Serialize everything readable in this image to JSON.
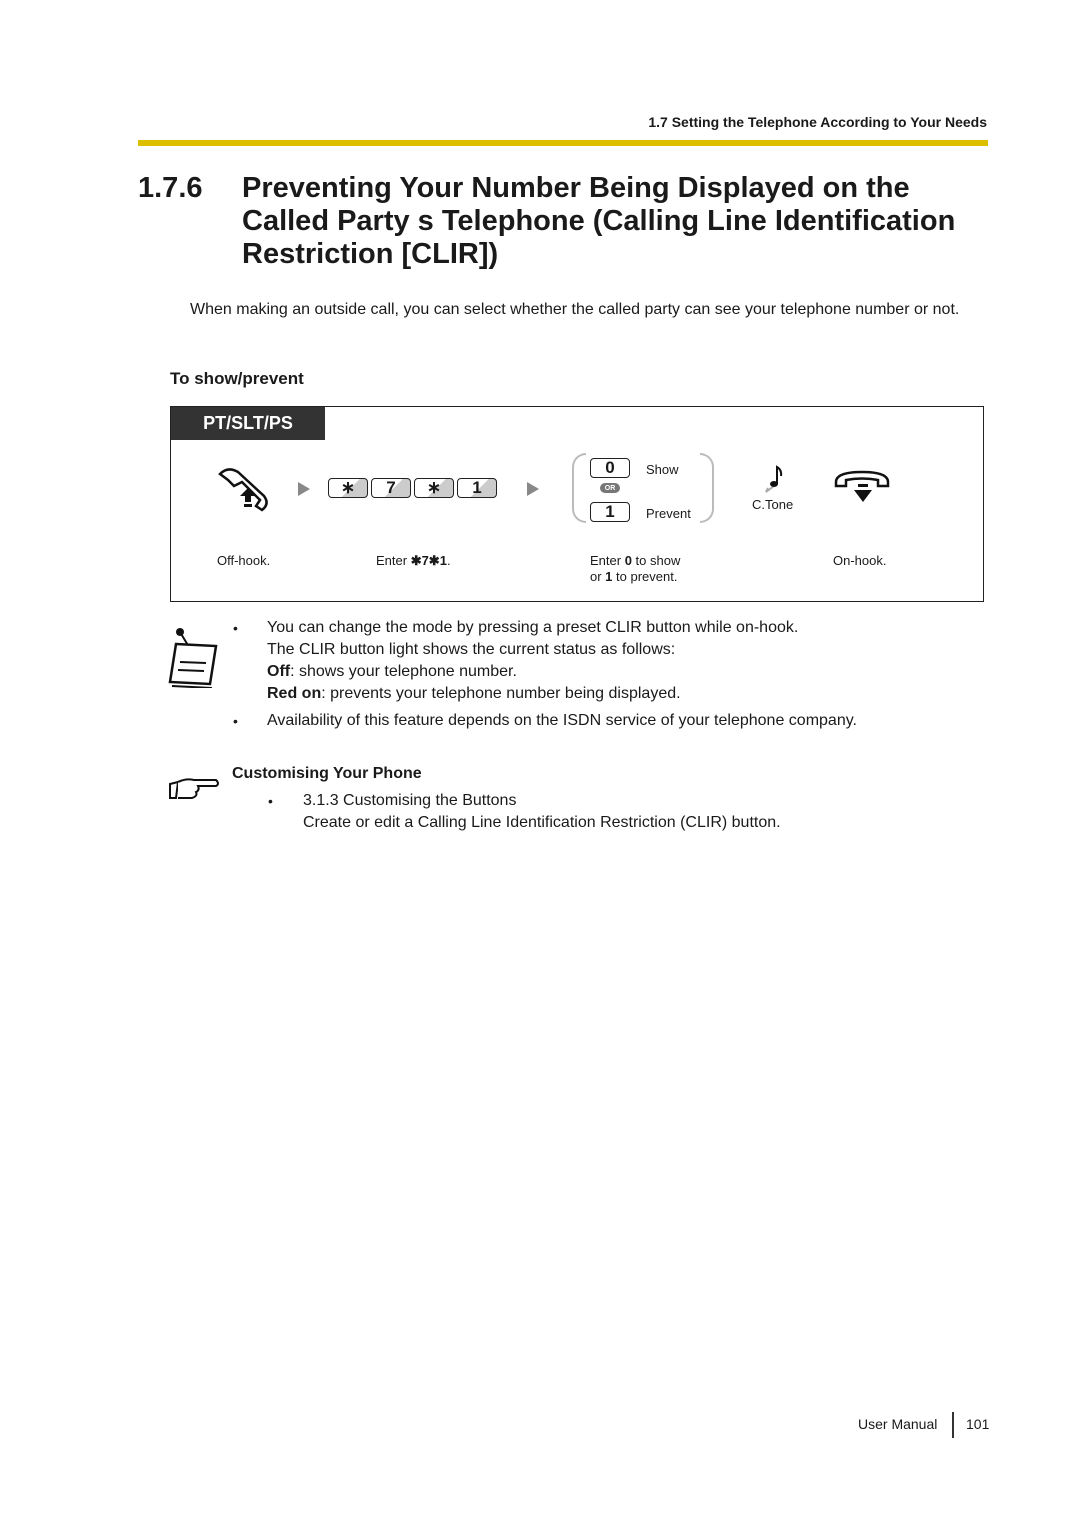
{
  "header": {
    "running_head": "1.7 Setting the Telephone According to Your Needs",
    "rule_color": "#dcc000"
  },
  "section": {
    "number": "1.7.6",
    "title_lines": [
      "Preventing Your Number Being Displayed on the",
      "Called Party s Telephone (Calling Line Identification",
      "Restriction [CLIR])"
    ],
    "intro": "When making an outside call, you can select whether the called party can see your telephone number or not.",
    "subheading": "To show/prevent"
  },
  "procedure": {
    "tab_label": "PT/SLT/PS",
    "keys": [
      "∗",
      "7",
      "∗",
      "1"
    ],
    "options": [
      {
        "key": "0",
        "label": "Show"
      },
      {
        "key": "1",
        "label": "Prevent"
      }
    ],
    "or_label": "OR",
    "tone_label": "C.Tone",
    "captions": {
      "off_hook": "Off-hook.",
      "enter_prefix": "Enter ",
      "enter_code": "✱7✱1",
      "enter_suffix": ".",
      "choose_line1_a": "Enter ",
      "choose_line1_b": "0",
      "choose_line1_c": " to show",
      "choose_line2_a": "or ",
      "choose_line2_b": "1",
      "choose_line2_c": " to prevent.",
      "on_hook": "On-hook."
    }
  },
  "notes": {
    "bullet1_line1": "You can change the mode by pressing a preset CLIR button while on-hook.",
    "bullet1_line2": "The CLIR button light shows the current status as follows:",
    "off_label": "Off",
    "off_text": ": shows your telephone number.",
    "red_label": "Red on",
    "red_text": ": prevents your telephone number being displayed.",
    "bullet2": "Availability of this feature depends on the ISDN service of your telephone company."
  },
  "reference": {
    "heading": "Customising Your Phone",
    "item_title": "3.1.3 Customising the Buttons",
    "item_desc": "Create or edit a Calling Line Identification Restriction (CLIR) button."
  },
  "footer": {
    "label": "User Manual",
    "page": "101"
  }
}
